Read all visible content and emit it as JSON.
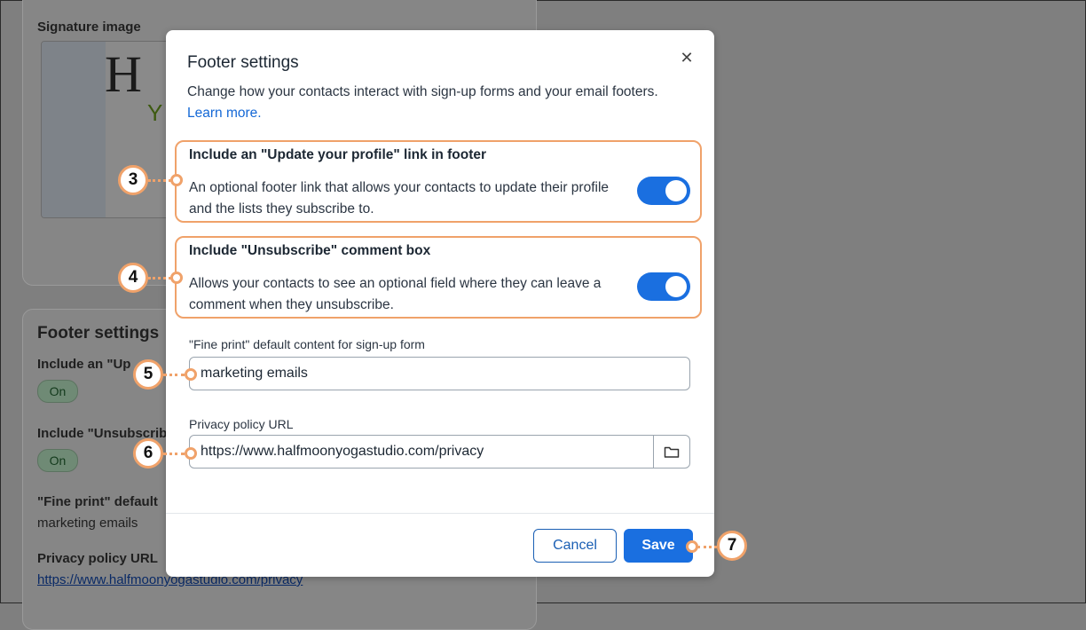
{
  "background": {
    "signature_label": "Signature image",
    "footer_title": "Footer settings",
    "profile_label": "Include an \"Up",
    "profile_value": "On",
    "unsub_label": "Include \"Unsubscrib",
    "unsub_value": "On",
    "fine_print_label": "\"Fine print\" default",
    "fine_print_value": "marketing emails",
    "privacy_label": "Privacy policy URL",
    "privacy_value": "https://www.halfmoonyogastudio.com/privacy"
  },
  "modal": {
    "title": "Footer settings",
    "close_glyph": "✕",
    "description": "Change how your contacts interact with sign-up forms and your email footers.",
    "learn_more": "Learn more.",
    "sections": [
      {
        "heading": "Include an \"Update your profile\" link in footer",
        "body": "An optional footer link that allows your contacts to update their profile and the lists they subscribe to.",
        "enabled": true
      },
      {
        "heading": "Include \"Unsubscribe\" comment box",
        "body": "Allows your contacts to see an optional field where they can leave a comment when they unsubscribe.",
        "enabled": true
      }
    ],
    "fine_print": {
      "label": "\"Fine print\" default content for sign-up form",
      "value": "marketing emails"
    },
    "privacy": {
      "label": "Privacy policy URL",
      "value": "https://www.halfmoonyogastudio.com/privacy",
      "icon": "folder-icon"
    },
    "cancel_label": "Cancel",
    "save_label": "Save"
  },
  "callouts": [
    "3",
    "4",
    "5",
    "6",
    "7"
  ],
  "colors": {
    "accent": "#1a6fe0",
    "callout": "#f0a26a",
    "link": "#1468d6"
  }
}
